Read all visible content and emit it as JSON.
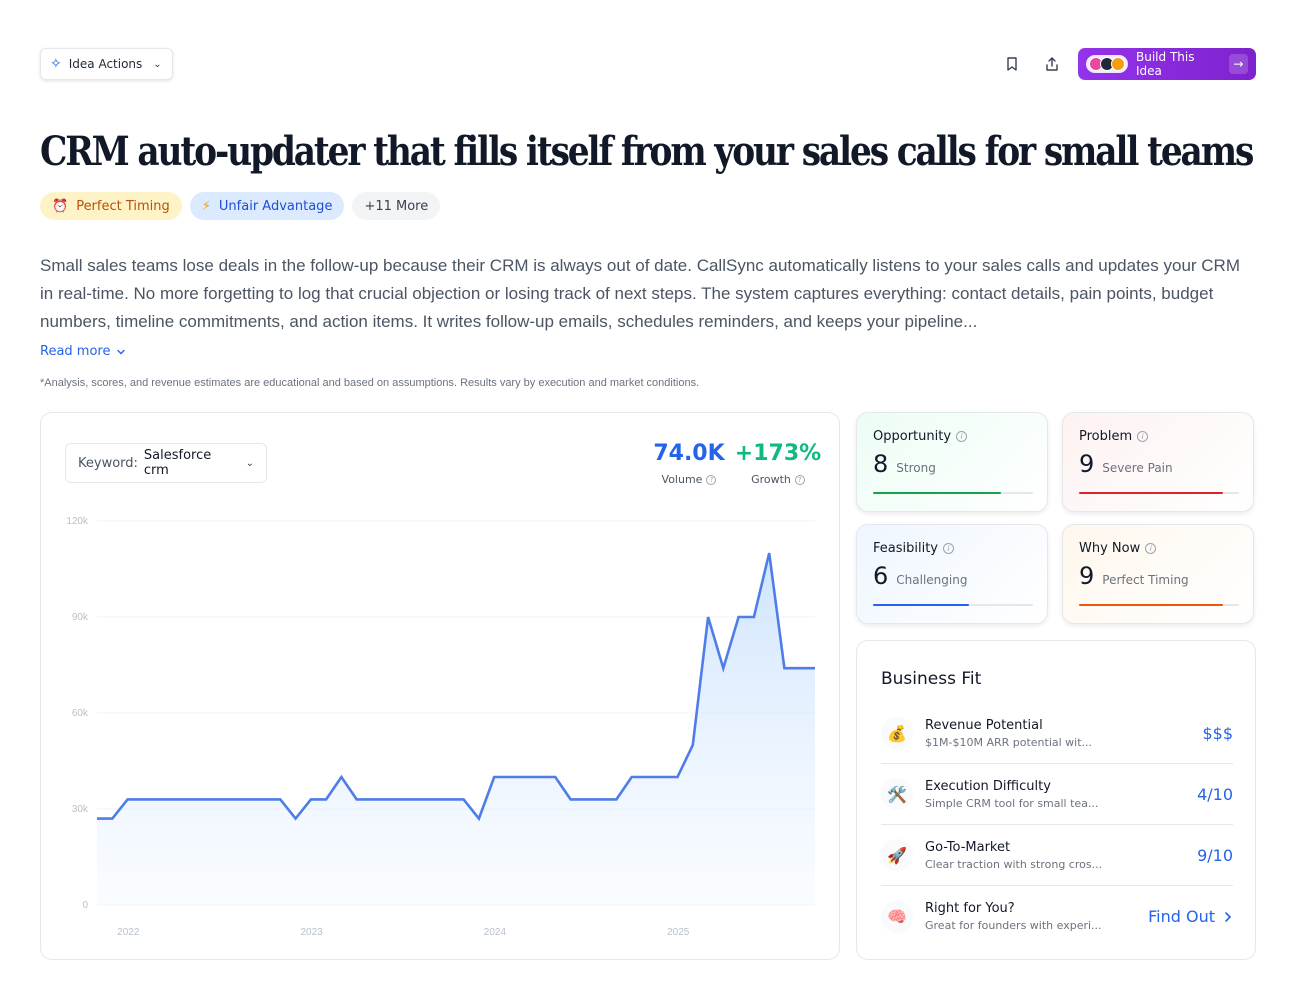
{
  "toolbar": {
    "idea_actions_label": "Idea Actions",
    "build_label": "Build This Idea"
  },
  "idea": {
    "title": "CRM auto-updater that fills itself from your sales calls for small teams",
    "tags": [
      {
        "icon": "⏰",
        "label": "Perfect Timing"
      },
      {
        "icon": "⚡",
        "label": "Unfair Advantage"
      },
      {
        "label": "+11 More"
      }
    ],
    "description": "Small sales teams lose deals in the follow-up because their CRM is always out of date. CallSync automatically listens to your sales calls and updates your CRM in real-time. No more forgetting to log that crucial objection or losing track of next steps. The system captures everything: contact details, pain points, budget numbers, timeline commitments, and action items. It writes follow-up emails, schedules reminders, and keeps your pipeline...",
    "read_more": "Read more",
    "disclaimer": "*Analysis, scores, and revenue estimates are educational and based on assumptions. Results vary by execution and market conditions."
  },
  "trend": {
    "keyword_label": "Keyword:",
    "keyword_value": "Salesforce crm",
    "volume_value": "74.0K",
    "volume_label": "Volume",
    "growth_value": "+173%",
    "growth_label": "Growth"
  },
  "chart_data": {
    "type": "area",
    "y_ticks": [
      "0",
      "30k",
      "60k",
      "90k",
      "120k"
    ],
    "ylim": [
      0,
      120000
    ],
    "x_ticks": [
      "2022",
      "2023",
      "2024",
      "2025"
    ],
    "x_tick_index": [
      1,
      13,
      25,
      37
    ],
    "color": "#4f7de8",
    "values": [
      27000,
      27000,
      33000,
      33000,
      33000,
      33000,
      33000,
      33000,
      33000,
      33000,
      33000,
      33000,
      33000,
      27000,
      33000,
      33000,
      40000,
      33000,
      33000,
      33000,
      33000,
      33000,
      33000,
      33000,
      33000,
      27000,
      40000,
      40000,
      40000,
      40000,
      40000,
      33000,
      33000,
      33000,
      33000,
      40000,
      40000,
      40000,
      40000,
      50000,
      90000,
      74000,
      90000,
      90000,
      110000,
      74000,
      74000,
      74000
    ]
  },
  "scores": [
    {
      "label": "Opportunity",
      "value": "8",
      "word": "Strong",
      "fill": 0.8,
      "color": "#16a34a"
    },
    {
      "label": "Problem",
      "value": "9",
      "word": "Severe Pain",
      "fill": 0.9,
      "color": "#dc2626"
    },
    {
      "label": "Feasibility",
      "value": "6",
      "word": "Challenging",
      "fill": 0.6,
      "color": "#2563eb"
    },
    {
      "label": "Why Now",
      "value": "9",
      "word": "Perfect Timing",
      "fill": 0.9,
      "color": "#ea580c"
    }
  ],
  "business_fit": {
    "title": "Business Fit",
    "rows": [
      {
        "icon": "💰",
        "title": "Revenue Potential",
        "subtitle": "$1M-$10M ARR potential wit...",
        "value": "$$$"
      },
      {
        "icon": "🛠️",
        "title": "Execution Difficulty",
        "subtitle": "Simple CRM tool for small tea...",
        "value": "4/10"
      },
      {
        "icon": "🚀",
        "title": "Go-To-Market",
        "subtitle": "Clear traction with strong cros...",
        "value": "9/10"
      },
      {
        "icon": "🧠",
        "title": "Right for You?",
        "subtitle": "Great for founders with experi...",
        "value": "Find Out"
      }
    ]
  }
}
